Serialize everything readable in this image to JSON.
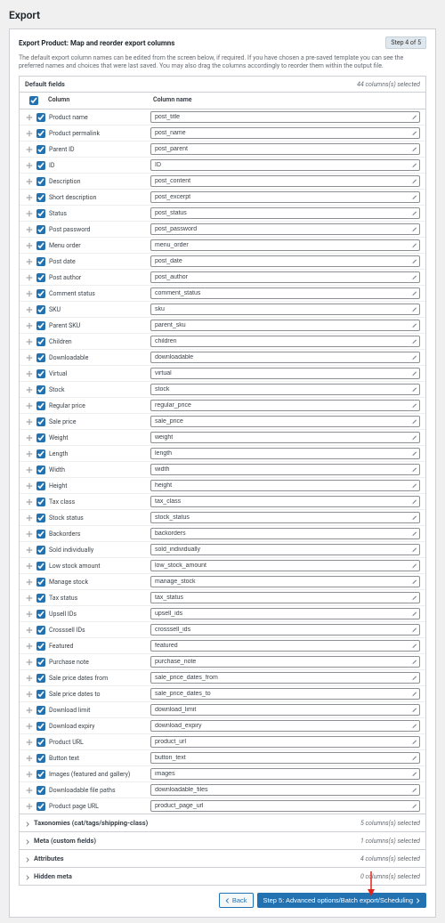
{
  "page": {
    "title": "Export"
  },
  "panel": {
    "title": "Export Product: Map and reorder export columns",
    "step_badge": "Step 4 of 5",
    "description": "The default export column names can be edited from the screen below, if required. If you have chosen a pre-saved template you can see the preferred names and choices that were last saved. You may also drag the columns accordingly to reorder them within the output file."
  },
  "default_fields": {
    "label": "Default fields",
    "count_text": "44 columns(s) selected",
    "head_col1": "Column",
    "head_col2": "Column name",
    "rows": [
      {
        "label": "Product name",
        "value": "post_title"
      },
      {
        "label": "Product permalink",
        "value": "post_name"
      },
      {
        "label": "Parent ID",
        "value": "post_parent"
      },
      {
        "label": "ID",
        "value": "ID"
      },
      {
        "label": "Description",
        "value": "post_content"
      },
      {
        "label": "Short description",
        "value": "post_excerpt"
      },
      {
        "label": "Status",
        "value": "post_status"
      },
      {
        "label": "Post password",
        "value": "post_password"
      },
      {
        "label": "Menu order",
        "value": "menu_order"
      },
      {
        "label": "Post date",
        "value": "post_date"
      },
      {
        "label": "Post author",
        "value": "post_author"
      },
      {
        "label": "Comment status",
        "value": "comment_status"
      },
      {
        "label": "SKU",
        "value": "sku"
      },
      {
        "label": "Parent SKU",
        "value": "parent_sku"
      },
      {
        "label": "Children",
        "value": "children"
      },
      {
        "label": "Downloadable",
        "value": "downloadable"
      },
      {
        "label": "Virtual",
        "value": "virtual"
      },
      {
        "label": "Stock",
        "value": "stock"
      },
      {
        "label": "Regular price",
        "value": "regular_price"
      },
      {
        "label": "Sale price",
        "value": "sale_price"
      },
      {
        "label": "Weight",
        "value": "weight"
      },
      {
        "label": "Length",
        "value": "length"
      },
      {
        "label": "Width",
        "value": "width"
      },
      {
        "label": "Height",
        "value": "height"
      },
      {
        "label": "Tax class",
        "value": "tax_class"
      },
      {
        "label": "Stock status",
        "value": "stock_status"
      },
      {
        "label": "Backorders",
        "value": "backorders"
      },
      {
        "label": "Sold individually",
        "value": "sold_individually"
      },
      {
        "label": "Low stock amount",
        "value": "low_stock_amount"
      },
      {
        "label": "Manage stock",
        "value": "manage_stock"
      },
      {
        "label": "Tax status",
        "value": "tax_status"
      },
      {
        "label": "Upsell IDs",
        "value": "upsell_ids"
      },
      {
        "label": "Crosssell IDs",
        "value": "crosssell_ids"
      },
      {
        "label": "Featured",
        "value": "featured"
      },
      {
        "label": "Purchase note",
        "value": "purchase_note"
      },
      {
        "label": "Sale price dates from",
        "value": "sale_price_dates_from"
      },
      {
        "label": "Sale price dates to",
        "value": "sale_price_dates_to"
      },
      {
        "label": "Download limit",
        "value": "download_limit"
      },
      {
        "label": "Download expiry",
        "value": "download_expiry"
      },
      {
        "label": "Product URL",
        "value": "product_url"
      },
      {
        "label": "Button text",
        "value": "button_text"
      },
      {
        "label": "Images (featured and gallery)",
        "value": "images"
      },
      {
        "label": "Downloadable file paths",
        "value": "downloadable_files"
      },
      {
        "label": "Product page URL",
        "value": "product_page_url"
      }
    ]
  },
  "accordions": [
    {
      "label": "Taxonomies (cat/tags/shipping-class)",
      "count": "5 columns(s) selected"
    },
    {
      "label": "Meta (custom fields)",
      "count": "1 columns(s) selected"
    },
    {
      "label": "Attributes",
      "count": "4 columns(s) selected"
    },
    {
      "label": "Hidden meta",
      "count": "0 columns(s) selected"
    }
  ],
  "footer": {
    "back": "Back",
    "next": "Step 5: Advanced options/Batch export/Scheduling"
  },
  "icons": {
    "drag": "move",
    "pencil": "edit"
  }
}
